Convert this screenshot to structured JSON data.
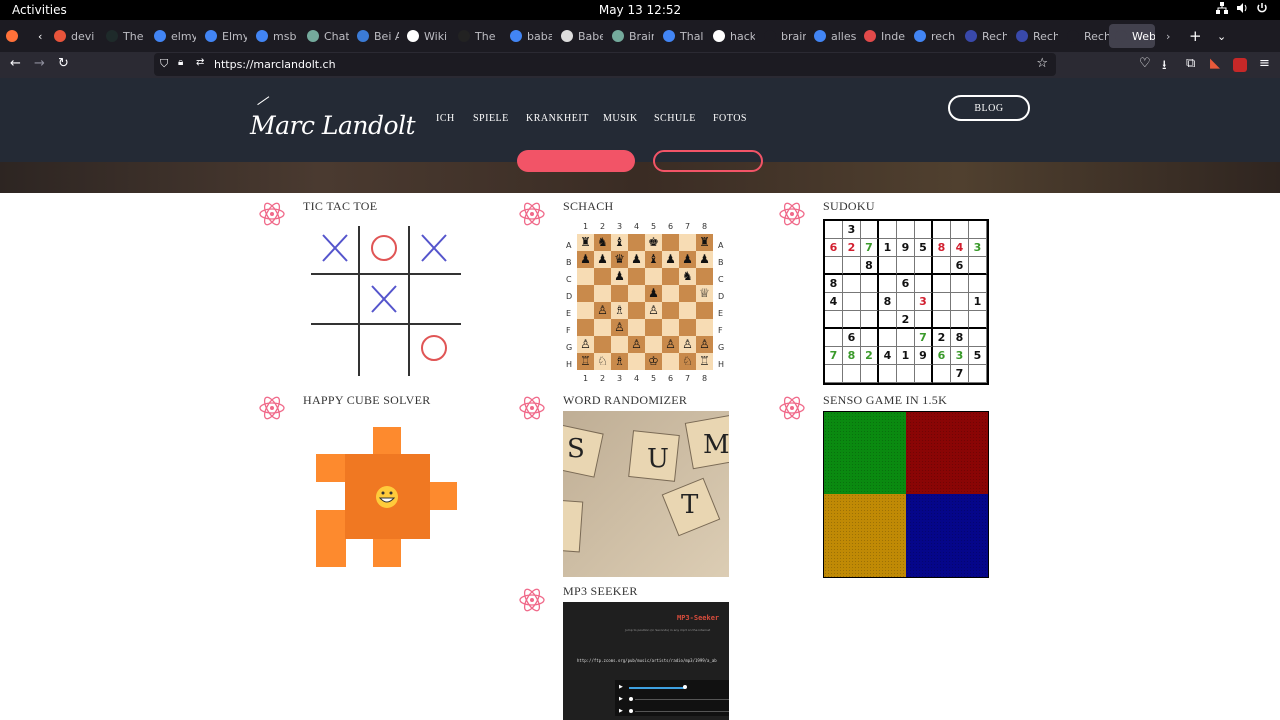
{
  "system": {
    "activities": "Activities",
    "clock": "May 13  12:52"
  },
  "browser": {
    "tabs": [
      {
        "label": "devi",
        "color": "#e8543b"
      },
      {
        "label": "The",
        "color": "#1e2a2a"
      },
      {
        "label": "elmy",
        "color": "#4285f4"
      },
      {
        "label": "Elmy",
        "color": "#4285f4"
      },
      {
        "label": "msb",
        "color": "#4285f4"
      },
      {
        "label": "Chat",
        "color": "#74aa9c"
      },
      {
        "label": "Bei A",
        "color": "#3b7bd6"
      },
      {
        "label": "Wiki",
        "color": "#ffffff"
      },
      {
        "label": "The",
        "color": "#222222"
      },
      {
        "label": "baba",
        "color": "#4285f4"
      },
      {
        "label": "Babe",
        "color": "#dddddd"
      },
      {
        "label": "Brain",
        "color": "#74aa9c"
      },
      {
        "label": "Thal",
        "color": "#4285f4"
      },
      {
        "label": "hack",
        "color": "#ffffff"
      },
      {
        "label": "brainjack",
        "color": "#1c1b22"
      },
      {
        "label": "alles",
        "color": "#4285f4"
      },
      {
        "label": "Inde",
        "color": "#e24a4a"
      },
      {
        "label": "rech",
        "color": "#4285f4"
      },
      {
        "label": "Rech",
        "color": "#3949ab"
      },
      {
        "label": "Rech",
        "color": "#3949ab"
      },
      {
        "label": "Rechner",
        "color": "#1c1b22"
      },
      {
        "label": "Webs",
        "color": "#42414d"
      }
    ],
    "url": "https://marclandolt.ch"
  },
  "site": {
    "logo": "Marc Landolt",
    "menu": [
      "ICH",
      "SPIELE",
      "KRANKHEIT",
      "MUSIK",
      "SCHULE",
      "FOTOS"
    ],
    "blog": "BLOG",
    "accent": "#f25467"
  },
  "projects": [
    {
      "title": "TIC TAC TOE"
    },
    {
      "title": "SCHACH"
    },
    {
      "title": "SUDOKU"
    },
    {
      "title": "HAPPY CUBE SOLVER"
    },
    {
      "title": "WORD RANDOMIZER"
    },
    {
      "title": "SENSO GAME IN 1.5K"
    },
    {
      "title": "MP3 SEEKER"
    }
  ],
  "tictactoe": {
    "cells": [
      "X",
      "O",
      "X",
      "",
      "X",
      "",
      "",
      "",
      "O"
    ],
    "x_color": "#5555cc",
    "o_color": "#e05555"
  },
  "chess": {
    "col_labels": [
      "1",
      "2",
      "3",
      "4",
      "5",
      "6",
      "7",
      "8"
    ],
    "row_labels": [
      "A",
      "B",
      "C",
      "D",
      "E",
      "F",
      "G",
      "H"
    ],
    "board": [
      [
        "♜",
        "♞",
        "♝",
        "",
        "♚",
        "",
        "",
        "♜"
      ],
      [
        "♟",
        "♟",
        "♛",
        "♟",
        "♝",
        "♟",
        "♟",
        "♟"
      ],
      [
        "",
        "",
        "♟",
        "",
        "",
        "",
        "♞",
        ""
      ],
      [
        "",
        "",
        "",
        "",
        "♟",
        "",
        "",
        "♕"
      ],
      [
        "",
        "♙",
        "♗",
        "",
        "♙",
        "",
        "",
        ""
      ],
      [
        "",
        "",
        "♙",
        "",
        "",
        "",
        "",
        ""
      ],
      [
        "♙",
        "",
        "",
        "♙",
        "",
        "♙",
        "♙",
        "♙"
      ],
      [
        "♖",
        "♘",
        "♗",
        "",
        "♔",
        "",
        "♘",
        "♖"
      ]
    ]
  },
  "sudoku": {
    "grid": [
      [
        "",
        "3",
        "",
        "",
        "",
        "",
        "",
        "",
        ""
      ],
      [
        "6",
        "2",
        "7",
        "1",
        "9",
        "5",
        "8",
        "4",
        "3"
      ],
      [
        "",
        "",
        "8",
        "",
        "",
        "",
        "",
        "6",
        ""
      ],
      [
        "8",
        "",
        "",
        "",
        "6",
        "",
        "",
        "",
        ""
      ],
      [
        "4",
        "",
        "",
        "8",
        "",
        "3",
        "",
        "",
        "1"
      ],
      [
        "",
        "",
        "",
        "",
        "2",
        "",
        "",
        "",
        ""
      ],
      [
        "",
        "6",
        "",
        "",
        "",
        "7",
        "2",
        "8",
        ""
      ],
      [
        "7",
        "8",
        "2",
        "4",
        "1",
        "9",
        "6",
        "3",
        "5"
      ],
      [
        "",
        "",
        "",
        "",
        "",
        "",
        "",
        "7",
        ""
      ]
    ],
    "colors": [
      [
        "k",
        "k",
        "k",
        "k",
        "k",
        "k",
        "k",
        "k",
        "k"
      ],
      [
        "r",
        "r",
        "g",
        "k",
        "k",
        "k",
        "r",
        "r",
        "g"
      ],
      [
        "k",
        "k",
        "k",
        "k",
        "k",
        "k",
        "k",
        "k",
        "k"
      ],
      [
        "k",
        "k",
        "k",
        "k",
        "k",
        "k",
        "k",
        "k",
        "k"
      ],
      [
        "k",
        "k",
        "k",
        "k",
        "k",
        "r",
        "k",
        "k",
        "k"
      ],
      [
        "k",
        "k",
        "k",
        "k",
        "k",
        "k",
        "k",
        "k",
        "k"
      ],
      [
        "k",
        "k",
        "k",
        "k",
        "k",
        "g",
        "k",
        "k",
        "k"
      ],
      [
        "g",
        "g",
        "g",
        "k",
        "k",
        "k",
        "g",
        "g",
        "k"
      ],
      [
        "k",
        "k",
        "k",
        "k",
        "k",
        "k",
        "k",
        "k",
        "k"
      ]
    ]
  },
  "senso": {
    "colors": [
      "#0a8a10",
      "#8a0505",
      "#c08a05",
      "#05068a"
    ]
  },
  "mp3seeker": {
    "title": "MP3-Seeker",
    "subtitle": "Jump to position (in Seconds) in any mp3 on the internet",
    "link": "http://ftp.zcoms.org/pub/music/artists/radio/mp3/1999/a_ab"
  }
}
